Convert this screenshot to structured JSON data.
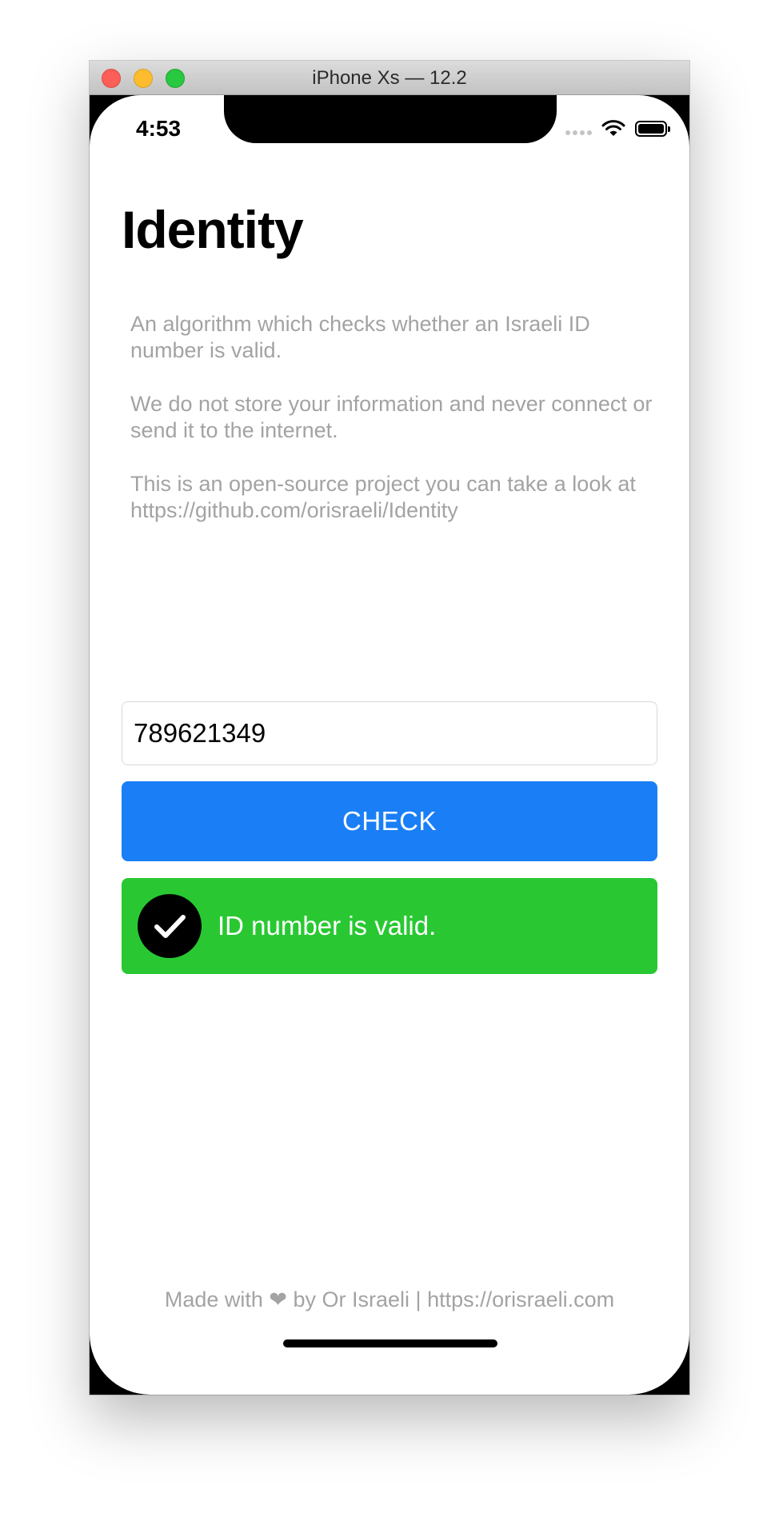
{
  "window": {
    "title": "iPhone Xs — 12.2"
  },
  "status_bar": {
    "time": "4:53",
    "icons": [
      "signal-dots-icon",
      "wifi-icon",
      "battery-icon"
    ]
  },
  "page": {
    "title": "Identity",
    "description": [
      "An algorithm which checks whether an Israeli ID number is valid.",
      "We do not store your information and never connect or send it to the internet.",
      "This is an open-source project you can take a look at https://github.com/orisraeli/Identity"
    ]
  },
  "form": {
    "id_value": "789621349",
    "check_label": "CHECK"
  },
  "result": {
    "icon": "checkmark-icon",
    "text": "ID number is valid.",
    "color": "#29c832"
  },
  "footer": {
    "text": "Made with ❤ by Or Israeli | https://orisraeli.com"
  },
  "colors": {
    "accent": "#1a7ff6",
    "success": "#29c832",
    "muted_text": "#a3a3a3"
  }
}
